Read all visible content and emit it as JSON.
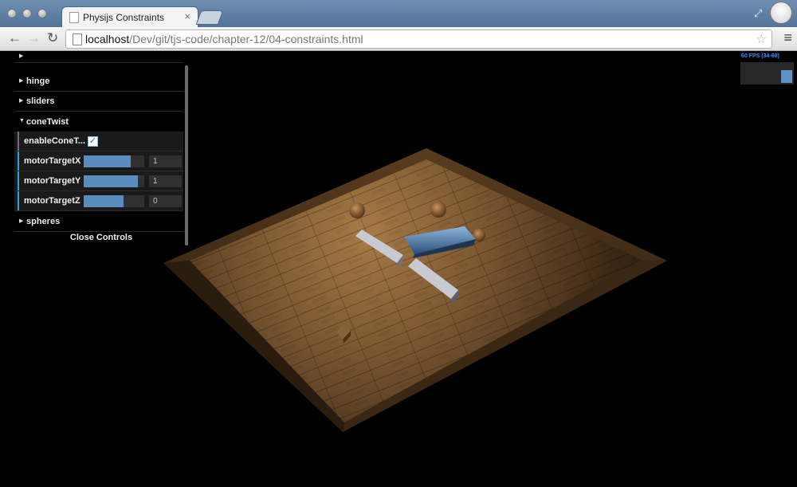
{
  "browser": {
    "tab": {
      "title": "Physijs Constraints",
      "close": "×"
    },
    "url": {
      "host": "localhost",
      "path": "/Dev/git/tjs-code/chapter-12/04-constraints.html"
    },
    "icons": {
      "back": "←",
      "forward": "→",
      "reload": "↻",
      "star": "☆",
      "menu": "≡",
      "fullscreen": "⤢"
    }
  },
  "gui": {
    "folders": [
      {
        "label": "hinge",
        "expanded": false
      },
      {
        "label": "sliders",
        "expanded": false
      },
      {
        "label": "coneTwist",
        "expanded": true
      },
      {
        "label": "spheres",
        "expanded": false
      }
    ],
    "controls": {
      "enableConeTwist": {
        "label": "enableConeT...",
        "checked": true,
        "check_mark": "✓"
      },
      "motorTargetX": {
        "label": "motorTargetX",
        "value": "1",
        "fill": 0.77
      },
      "motorTargetY": {
        "label": "motorTargetY",
        "value": "1",
        "fill": 0.9
      },
      "motorTargetZ": {
        "label": "motorTargetZ",
        "value": "0",
        "fill": 0.66
      }
    },
    "close_label": "Close Controls",
    "colors": {
      "slider_fill": "#5a8cbf",
      "checkbox_bar": "#806787",
      "number_bar": "#2fa1d6"
    }
  },
  "stats": {
    "text": "60 FPS (34-60)"
  }
}
